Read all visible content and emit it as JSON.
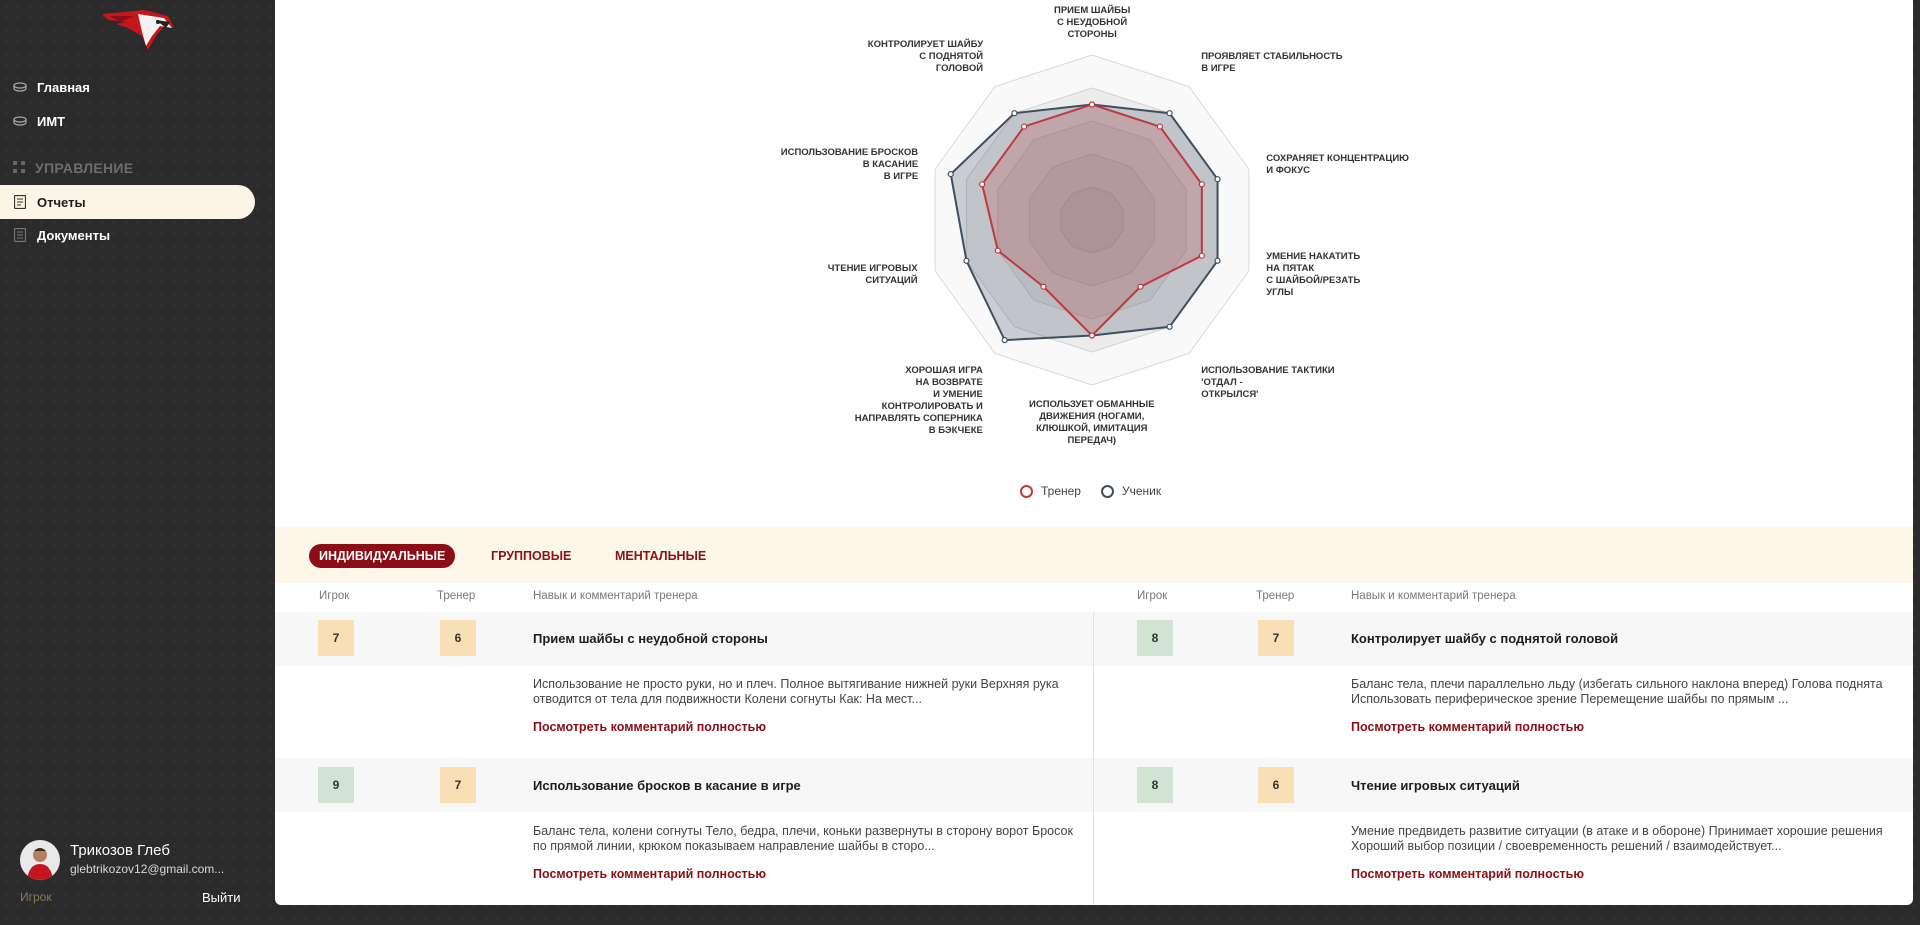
{
  "sidebar": {
    "items": [
      {
        "label": "Главная",
        "icon": "puck-icon"
      },
      {
        "label": "ИМТ",
        "icon": "puck-icon"
      }
    ],
    "section": "УПРАВЛЕНИЕ",
    "manage_items": [
      {
        "label": "Отчеты",
        "icon": "report-icon",
        "active": true
      },
      {
        "label": "Документы",
        "icon": "document-icon"
      }
    ],
    "user": {
      "name": "Трикозов Глеб",
      "email": "glebtrikozov12@gmail.com...",
      "role": "Игрок",
      "logout": "Выйти"
    }
  },
  "radar": {
    "labels": [
      "ПРИЕМ ШАЙБЫ\nС НЕУДОБНОЙ\nСТОРОНЫ",
      "ПРОЯВЛЯЕТ СТАБИЛЬНОСТЬ\nВ ИГРЕ",
      "СОХРАНЯЕТ КОНЦЕНТРАЦИЮ\nИ ФОКУС",
      "УМЕНИЕ НАКАТИТЬ\nНА ПЯТАК\nС ШАЙБОЙ/РЕЗАТЬ\nУГЛЫ",
      "ИСПОЛЬЗОВАНИЕ ТАКТИКИ\n'ОТДАЛ -\nОТКРЫЛСЯ'",
      "ИСПОЛЬЗУЕТ ОБМАННЫЕ\nДВИЖЕНИЯ (НОГАМИ,\nКЛЮШКОЙ, ИМИТАЦИЯ\nПЕРЕДАЧ)",
      "ХОРОШАЯ ИГРА\nНА ВОЗВРАТЕ\nИ УМЕНИЕ\nКОНТРОЛИРОВАТЬ И\nНАПРАВЛЯТЬ СОПЕРНИКА\nВ БЭКЧЕКЕ",
      "ЧТЕНИЕ ИГРОВЫХ\nСИТУАЦИЙ",
      "ИСПОЛЬЗОВАНИЕ БРОСКОВ\nВ КАСАНИЕ\nВ ИГРЕ",
      "КОНТРОЛИРУЕТ ШАЙБУ\nС ПОДНЯТОЙ\nГОЛОВОЙ"
    ],
    "series": [
      {
        "name": "Тренер",
        "color": "#c0383f",
        "values": [
          7,
          7,
          7,
          7,
          5,
          7,
          5,
          6,
          7,
          7
        ]
      },
      {
        "name": "Ученик",
        "color": "#3f4f5e",
        "values": [
          7,
          8,
          8,
          8,
          8,
          7,
          9,
          8,
          9,
          8
        ]
      }
    ],
    "max": 10
  },
  "tabs": [
    {
      "label": "ИНДИВИДУАЛЬНЫЕ",
      "active": true
    },
    {
      "label": "ГРУППОВЫЕ"
    },
    {
      "label": "МЕНТАЛЬНЫЕ"
    }
  ],
  "columns": {
    "player": "Игрок",
    "coach": "Тренер",
    "skill": "Навык и комментарий тренера"
  },
  "link_label": "Посмотреть комментарий полностью",
  "skills": [
    {
      "player": "7",
      "coach": "6",
      "player_color": "orange",
      "coach_color": "orange",
      "title": "Прием шайбы с неудобной стороны",
      "comment": "Использование не просто руки, но и плеч. Полное вытягивание нижней руки Верхняя рука отводится от тела для подвижности Колени согнуты Как:  На мест..."
    },
    {
      "player": "8",
      "coach": "7",
      "player_color": "green",
      "coach_color": "orange",
      "title": "Контролирует шайбу с поднятой головой",
      "comment": "Баланс тела, плечи параллельно льду (избегать сильного наклона вперед) Голова поднята Использовать периферическое зрение Перемещение шайбы по прямым ..."
    },
    {
      "player": "9",
      "coach": "7",
      "player_color": "green",
      "coach_color": "orange",
      "title": "Использование бросков в касание в игре",
      "comment": "Баланс тела, колени согнуты Тело, бедра, плечи, коньки развернуты в сторону ворот Бросок по прямой линии, крюком показываем направление шайбы в сторо..."
    },
    {
      "player": "8",
      "coach": "6",
      "player_color": "green",
      "coach_color": "orange",
      "title": "Чтение игровых ситуаций",
      "comment": "Умение предвидеть развитие ситуации (в атаке и в обороне) Принимает хорошие решения Хороший выбор позиции / своевременность решений / взаимодействует..."
    }
  ]
}
